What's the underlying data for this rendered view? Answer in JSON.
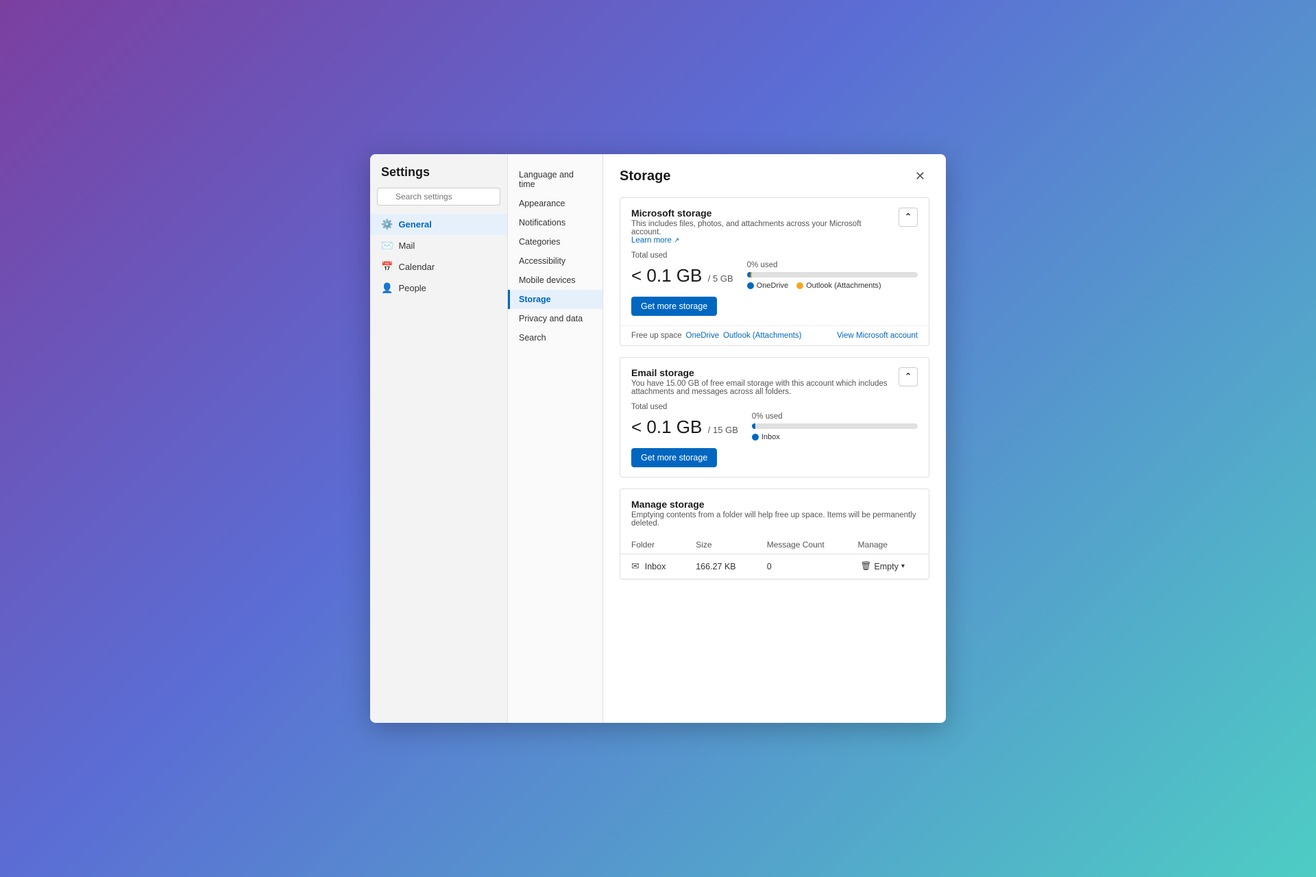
{
  "window": {
    "title": "Settings"
  },
  "leftNav": {
    "title": "Settings",
    "search_placeholder": "Search settings",
    "items": [
      {
        "id": "general",
        "label": "General",
        "icon": "⚙",
        "active": true
      },
      {
        "id": "mail",
        "label": "Mail",
        "icon": "✉",
        "active": false
      },
      {
        "id": "calendar",
        "label": "Calendar",
        "icon": "📅",
        "active": false
      },
      {
        "id": "people",
        "label": "People",
        "icon": "👤",
        "active": false
      }
    ]
  },
  "middleNav": {
    "items": [
      {
        "id": "language",
        "label": "Language and time",
        "active": false
      },
      {
        "id": "appearance",
        "label": "Appearance",
        "active": false
      },
      {
        "id": "notifications",
        "label": "Notifications",
        "active": false
      },
      {
        "id": "categories",
        "label": "Categories",
        "active": false
      },
      {
        "id": "accessibility",
        "label": "Accessibility",
        "active": false
      },
      {
        "id": "mobile",
        "label": "Mobile devices",
        "active": false
      },
      {
        "id": "storage",
        "label": "Storage",
        "active": true
      },
      {
        "id": "privacy",
        "label": "Privacy and data",
        "active": false
      },
      {
        "id": "search",
        "label": "Search",
        "active": false
      }
    ]
  },
  "main": {
    "title": "Storage",
    "microsoft_storage": {
      "title": "Microsoft storage",
      "desc": "This includes files, photos, and attachments across your Microsoft account.",
      "learn_more": "Learn more",
      "total_used_label": "Total used",
      "amount": "< 0.1 GB",
      "of": "/ 5 GB",
      "percent": "0% used",
      "progress_onedrive": 3,
      "progress_outlook": 0.5,
      "legend": [
        {
          "label": "OneDrive",
          "color": "#0067c0"
        },
        {
          "label": "Outlook (Attachments)",
          "color": "#f5a623"
        }
      ],
      "get_more_btn": "Get more storage",
      "free_up_label": "Free up space",
      "free_up_links": [
        "OneDrive",
        "Outlook (Attachments)"
      ],
      "view_account": "View Microsoft account"
    },
    "email_storage": {
      "title": "Email storage",
      "desc": "You have 15.00 GB of free email storage with this account which includes attachments and messages across all folders.",
      "total_used_label": "Total used",
      "amount": "< 0.1 GB",
      "of": "/ 15 GB",
      "percent": "0% used",
      "progress": 2,
      "legend": [
        {
          "label": "Inbox",
          "color": "#0067c0"
        }
      ],
      "get_more_btn": "Get more storage"
    },
    "manage_storage": {
      "title": "Manage storage",
      "desc": "Emptying contents from a folder will help free up space. Items will be permanently deleted.",
      "table": {
        "headers": [
          "Folder",
          "Size",
          "Message Count",
          "Manage"
        ],
        "rows": [
          {
            "folder": "Inbox",
            "size": "166.27 KB",
            "count": "0",
            "action": "Empty"
          }
        ]
      }
    }
  }
}
